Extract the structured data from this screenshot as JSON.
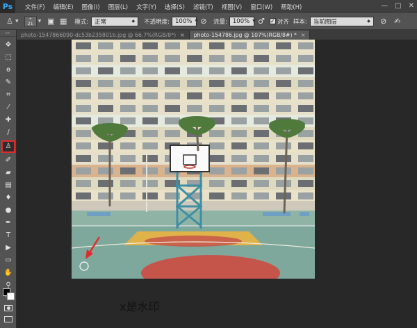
{
  "app": {
    "logo": "Ps"
  },
  "menu": [
    "文件(F)",
    "编辑(E)",
    "图像(I)",
    "图层(L)",
    "文字(Y)",
    "选择(S)",
    "滤镜(T)",
    "视图(V)",
    "窗口(W)",
    "帮助(H)"
  ],
  "window_controls": [
    "—",
    "□",
    "✕"
  ],
  "options": {
    "brush_size": "21",
    "mode_label": "模式:",
    "mode_value": "正常",
    "opacity_label": "不透明度:",
    "opacity_value": "100%",
    "flow_label": "流量:",
    "flow_value": "100%",
    "aligned_label": "对齐",
    "sample_label": "样本:",
    "sample_value": "当前图层"
  },
  "tabs": [
    {
      "label": "photo-1547866090-dc53b235801b.jpg @ 66.7%(RGB/8*)",
      "close": "×",
      "active": false
    },
    {
      "label": "photo-154786.jpg @ 107%(RGB/8#) *",
      "close": "×",
      "active": true
    }
  ],
  "tools": [
    {
      "name": "move-tool",
      "glyph": "✥"
    },
    {
      "name": "marquee-tool",
      "glyph": "⬚"
    },
    {
      "name": "lasso-tool",
      "glyph": "ɵ"
    },
    {
      "name": "quick-select-tool",
      "glyph": "✎"
    },
    {
      "name": "crop-tool",
      "glyph": "⌗"
    },
    {
      "name": "eyedropper-tool",
      "glyph": "⁄"
    },
    {
      "name": "healing-brush-tool",
      "glyph": "✚"
    },
    {
      "name": "brush-tool",
      "glyph": "/"
    },
    {
      "name": "clone-stamp-tool",
      "glyph": "♙"
    },
    {
      "name": "history-brush-tool",
      "glyph": "✐"
    },
    {
      "name": "eraser-tool",
      "glyph": "▰"
    },
    {
      "name": "gradient-tool",
      "glyph": "▤"
    },
    {
      "name": "blur-tool",
      "glyph": "♦"
    },
    {
      "name": "dodge-tool",
      "glyph": "●"
    },
    {
      "name": "pen-tool",
      "glyph": "✒"
    },
    {
      "name": "type-tool",
      "glyph": "T"
    },
    {
      "name": "path-select-tool",
      "glyph": "▶"
    },
    {
      "name": "shape-tool",
      "glyph": "▭"
    },
    {
      "name": "hand-tool",
      "glyph": "✋"
    },
    {
      "name": "zoom-tool",
      "glyph": "⚲"
    },
    {
      "name": "extra-tools",
      "glyph": "⋯"
    }
  ],
  "watermark_text": "x是水印",
  "colors": {
    "highlight_red": "#e12b2b",
    "court_red": "#c5554a",
    "court_green": "#7ea89c",
    "court_yellow": "#e0b24a"
  }
}
